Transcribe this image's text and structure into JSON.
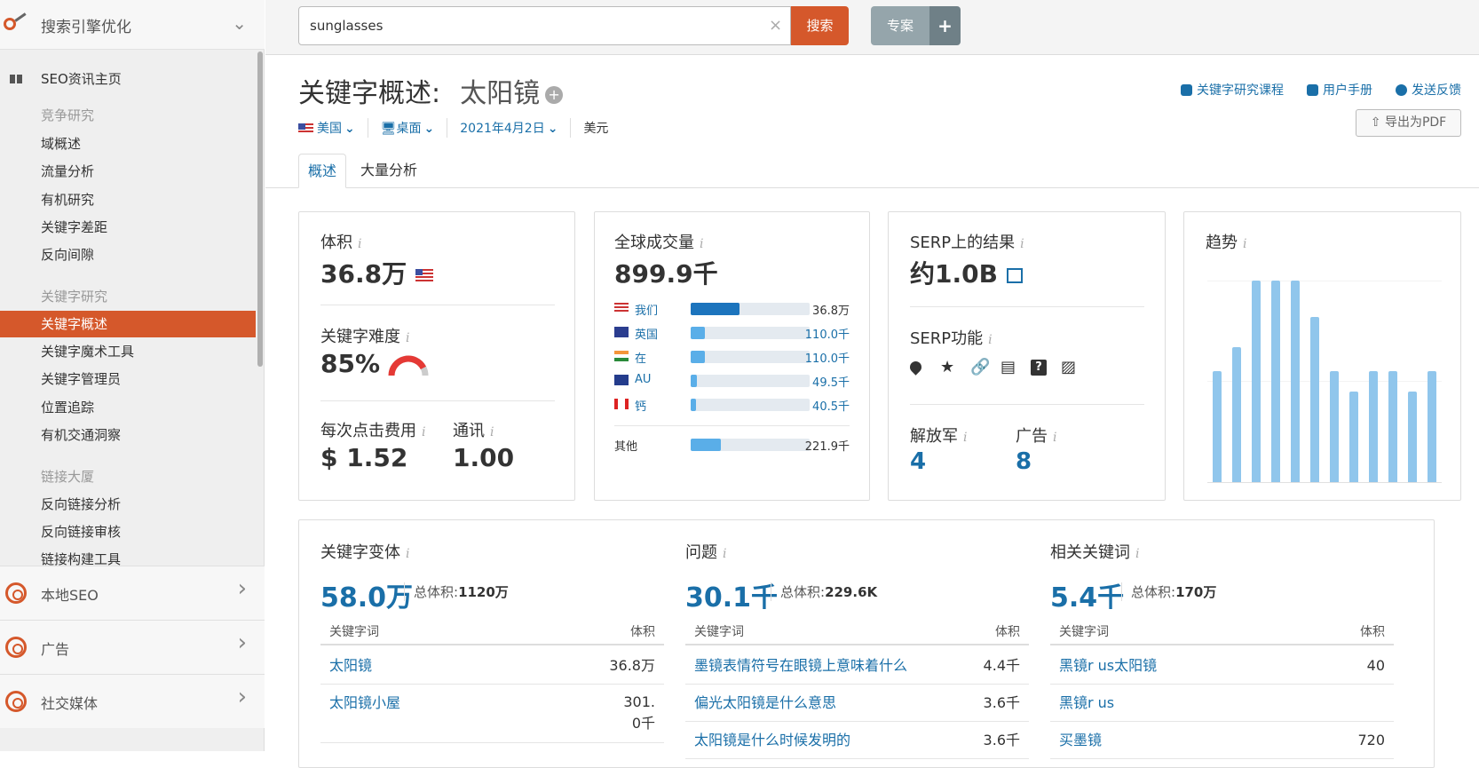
{
  "sidebar": {
    "header": "搜索引擎优化",
    "home": "SEO资讯主页",
    "items": [
      {
        "label": "竞争研究",
        "cat": true
      },
      {
        "label": "域概述"
      },
      {
        "label": "流量分析"
      },
      {
        "label": "有机研究"
      },
      {
        "label": "关键字差距"
      },
      {
        "label": "反向间隙"
      },
      {
        "label": "关键字研究",
        "cat": true
      },
      {
        "label": "关键字概述",
        "active": true
      },
      {
        "label": "关键字魔术工具"
      },
      {
        "label": "关键字管理员"
      },
      {
        "label": "位置追踪"
      },
      {
        "label": "有机交通洞察"
      },
      {
        "label": "链接大厦",
        "cat": true
      },
      {
        "label": "反向链接分析"
      },
      {
        "label": "反向链接审核"
      },
      {
        "label": "链接构建工具"
      }
    ],
    "sections": [
      "本地SEO",
      "广告",
      "社交媒体"
    ]
  },
  "topbar": {
    "search_value": "sunglasses",
    "search_button": "搜索",
    "project_button": "专案",
    "plus": "+",
    "clear": "×"
  },
  "header": {
    "title": "关键字概述:",
    "keyword": "太阳镜",
    "country": "美国",
    "device": "桌面",
    "date": "2021年4月2日",
    "currency": "美元",
    "links": [
      "关键字研究课程",
      "用户手册",
      "发送反馈"
    ],
    "export": "导出为PDF"
  },
  "tabs": [
    "概述",
    "大量分析"
  ],
  "volume": {
    "label": "体积",
    "value": "36.8万"
  },
  "difficulty": {
    "label": "关键字难度",
    "value": "85%",
    "percent": 85
  },
  "cpc": {
    "label": "每次点击费用",
    "value": "$ 1.52"
  },
  "com": {
    "label": "通讯",
    "value": "1.00"
  },
  "global": {
    "label": "全球成交量",
    "value": "899.9千",
    "countries": [
      {
        "name": "我们",
        "value": "36.8万",
        "fill": 0.41,
        "flag": "us"
      },
      {
        "name": "英国",
        "value": "110.0千",
        "fill": 0.12,
        "flag": "uk"
      },
      {
        "name": "在",
        "value": "110.0千",
        "fill": 0.12,
        "flag": "in"
      },
      {
        "name": "AU",
        "value": "49.5千",
        "fill": 0.05,
        "flag": "au"
      },
      {
        "name": "钙",
        "value": "40.5千",
        "fill": 0.045,
        "flag": "ca"
      }
    ],
    "other": {
      "name": "其他",
      "value": "221.9千",
      "fill": 0.25
    }
  },
  "serp": {
    "label": "SERP上的结果",
    "value": "约1.0B",
    "features_label": "SERP功能",
    "features": [
      "location-icon",
      "star-icon",
      "link-icon",
      "news-icon",
      "question-icon",
      "image-icon"
    ],
    "paid_label": "解放军",
    "paid_value": "4",
    "ads_label": "广告",
    "ads_value": "8"
  },
  "trend": {
    "label": "趋势"
  },
  "chart_data": {
    "type": "bar",
    "title": "趋势",
    "values": [
      0.55,
      0.67,
      1.0,
      1.0,
      1.0,
      0.82,
      0.55,
      0.45,
      0.55,
      0.55,
      0.45,
      0.55
    ],
    "ylim": [
      0,
      1
    ]
  },
  "columns": [
    {
      "label": "关键字变体",
      "value": "58.0万",
      "total_label": "总体积:",
      "total": "1120万",
      "h1": "关键字词",
      "h2": "体积",
      "rows": [
        {
          "k": "太阳镜",
          "v": "36.8万"
        },
        {
          "k": "太阳镜小屋",
          "v": "301.0千"
        }
      ]
    },
    {
      "label": "问题",
      "value": "30.1千",
      "total_label": "总体积:",
      "total": "229.6K",
      "h1": "关键字词",
      "h2": "体积",
      "rows": [
        {
          "k": "墨镜表情符号在眼镜上意味着什么",
          "v": "4.4千"
        },
        {
          "k": "偏光太阳镜是什么意思",
          "v": "3.6千"
        },
        {
          "k": "太阳镜是什么时候发明的",
          "v": "3.6千"
        }
      ]
    },
    {
      "label": "相关关键词",
      "value": "5.4千",
      "total_label": "总体积:",
      "total": "170万",
      "h1": "关键字词",
      "h2": "体积",
      "rows": [
        {
          "k": "黑镜r us太阳镜",
          "v": "40"
        },
        {
          "k": "黑镜r us",
          "v": ""
        },
        {
          "k": "买墨镜",
          "v": "720"
        }
      ]
    }
  ],
  "colors": {
    "accent": "#d5582b",
    "link": "#1a6fa8",
    "bar": "#90c6ec"
  }
}
